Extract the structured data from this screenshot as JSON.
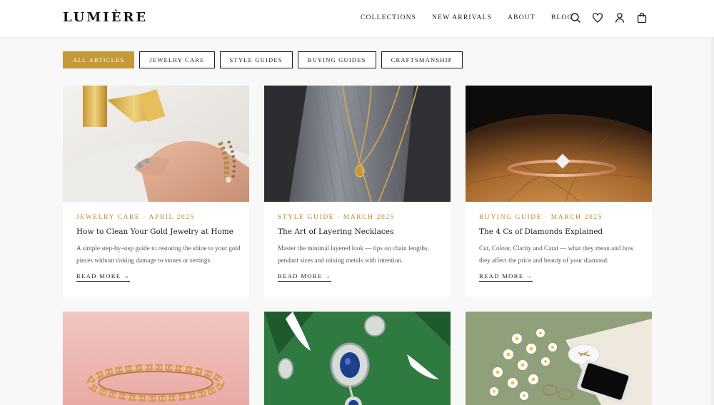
{
  "brand": {
    "logo": "LUMIÈRE"
  },
  "nav": [
    "COLLECTIONS",
    "NEW ARRIVALS",
    "ABOUT",
    "BLOG"
  ],
  "header_icons": [
    "search-icon",
    "heart-icon",
    "user-icon",
    "bag-icon"
  ],
  "filters": [
    {
      "label": "ALL ARTICLES",
      "active": true
    },
    {
      "label": "JEWELRY CARE",
      "active": false
    },
    {
      "label": "STYLE GUIDES",
      "active": false
    },
    {
      "label": "BUYING GUIDES",
      "active": false
    },
    {
      "label": "CRAFTSMANSHIP",
      "active": false
    }
  ],
  "articles": [
    {
      "meta": "JEWELRY CARE · APRIL 2025",
      "title": "How to Clean Your Gold Jewelry at Home",
      "excerpt": "A simple step-by-step guide to restoring the shine to your gold pieces without risking damage to stones or settings.",
      "read_more": "READ MORE"
    },
    {
      "meta": "STYLE GUIDE · MARCH 2025",
      "title": "The Art of Layering Necklaces",
      "excerpt": "Master the minimal layered look — tips on chain lengths, pendant sizes and mixing metals with intention.",
      "read_more": "READ MORE"
    },
    {
      "meta": "BUYING GUIDE · MARCH 2025",
      "title": "The 4 Cs of Diamonds Explained",
      "excerpt": "Cut, Colour, Clarity and Carat — what they mean and how they affect the price and beauty of your diamond.",
      "read_more": "READ MORE"
    }
  ],
  "colors": {
    "accent": "#c49a37",
    "meta_text": "#b8892c",
    "text": "#1a1a1a",
    "background": "#f8f8f8"
  }
}
